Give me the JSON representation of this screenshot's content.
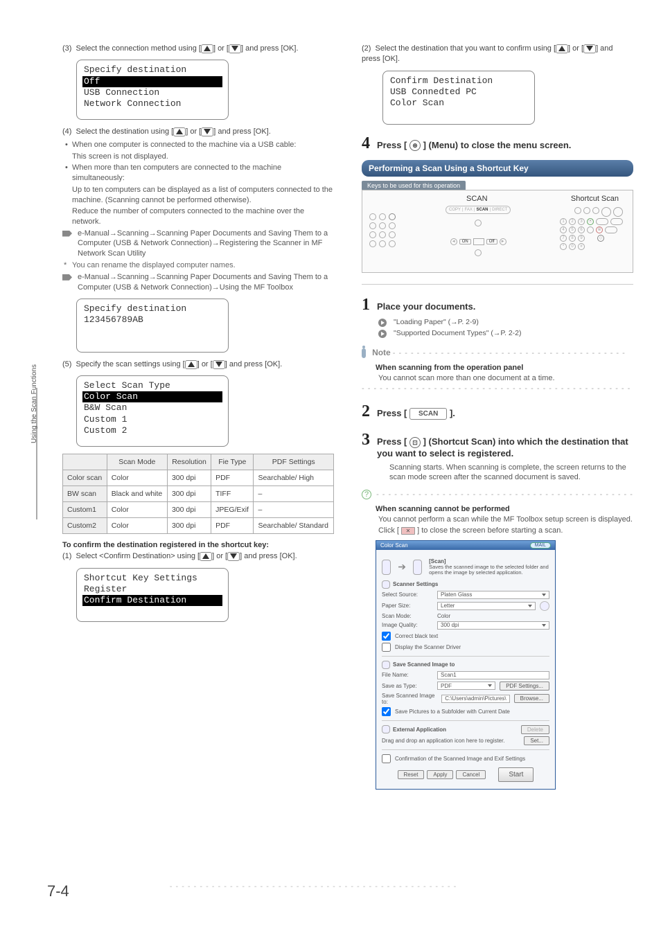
{
  "sidetab": "Using the Scan Functions",
  "pagenum": "7-4",
  "left": {
    "step3": "(3)  Select the connection method using [▲] or [▼] and press [OK].",
    "box1": {
      "title": "Specify destination",
      "hl": "Off",
      "l2": "USB Connection",
      "l3": "Network Connection"
    },
    "step4": "(4)  Select the destination using [▲] or [▼] and press [OK].",
    "b1": "When one computer is connected to the machine via a USB cable:",
    "b1s": "This screen is not displayed.",
    "b2": "When more than ten computers are connected to the machine simultaneously:",
    "b2s1": "Up to ten computers can be displayed as a list of computers connected to the machine. (Scanning cannot be performed otherwise).",
    "b2s2": "Reduce the number of computers connected to the machine over the network.",
    "ptr1": "e-Manual→Scanning→Scanning Paper Documents and Saving Them to a Computer (USB & Network Connection)→Registering the Scanner in MF Network Scan Utility",
    "star": "You can rename the displayed computer names.",
    "ptr2": "e-Manual→Scanning→Scanning Paper Documents and Saving Them to a Computer (USB & Network Connection)→Using the MF Toolbox",
    "box2": {
      "title": "Specify destination",
      "l1": "123456789AB"
    },
    "step5": "(5)  Specify the scan settings using [▲] or [▼] and press [OK].",
    "box3": {
      "title": "Select Scan Type",
      "hl": "Color Scan",
      "l2": "B&W Scan",
      "l3": "Custom 1",
      "l4": "Custom 2"
    },
    "table": {
      "headers": [
        "",
        "Scan Mode",
        "Resolution",
        "Fie Type",
        "PDF Settings"
      ],
      "rows": [
        [
          "Color scan",
          "Color",
          "300 dpi",
          "PDF",
          "Searchable/ High"
        ],
        [
          "BW scan",
          "Black and white",
          "300 dpi",
          "TIFF",
          "–"
        ],
        [
          "Custom1",
          "Color",
          "300 dpi",
          "JPEG/Exif",
          "–"
        ],
        [
          "Custom2",
          "Color",
          "300 dpi",
          "PDF",
          "Searchable/ Standard"
        ]
      ]
    },
    "confirm_head": "To confirm the destination registered in the shortcut key:",
    "confirm_step1": "(1)  Select <Confirm Destination> using [▲] or [▼] and press [OK].",
    "box4": {
      "title": "Shortcut Key Settings",
      "l1": "Register",
      "hl": "Confirm Destination"
    }
  },
  "right": {
    "step2top": "(2)  Select the destination that you want to confirm using [▲] or [▼] and press [OK].",
    "boxA": {
      "title": "Confirm Destination",
      "l1": "USB Connedted PC",
      "l2": "Color Scan"
    },
    "big4": "Press [       ] (Menu) to close the menu screen.",
    "menu_glyph": "⊛",
    "section": "Performing a Scan Using a Shortcut Key",
    "keys_label": "Keys to be used for this operation",
    "diag_scan": "SCAN",
    "diag_short": "Shortcut Scan",
    "big1": "Place your documents.",
    "ab1": "\"Loading Paper\" (→P. 2-9)",
    "ab2": "\"Supported Document Types\" (→P. 2-2)",
    "note": "Note",
    "note_head": "When scanning from the operation panel",
    "note_body": "You cannot scan more than one document at a time.",
    "big2_a": "Press [",
    "big2_b": "].",
    "scan_btn": "SCAN",
    "big3": "Press [      ] (Shortcut Scan) into which the destination that you want to select is registered.",
    "shortcut_glyph": "⊡",
    "big3_sub": "Scanning starts. When scanning is complete, the screen returns to the scan mode screen after the scanned document is saved.",
    "q_head": "When scanning cannot be performed",
    "q_body1": "You cannot perform a scan while the MF Toolbox setup screen is displayed.",
    "q_body2a": "Click [",
    "q_body2b": "] to close the screen before starting a scan.",
    "dialog": {
      "title": "Color Scan",
      "desc_head": "[Scan]",
      "desc": "Saves the scanned image to the selected folder and opens the image by selected application.",
      "sec1": "Scanner Settings",
      "src_l": "Select Source:",
      "src_v": "Platen Glass",
      "size_l": "Paper Size:",
      "size_v": "Letter",
      "mode_l": "Scan Mode:",
      "mode_v": "Color",
      "qual_l": "Image Quality:",
      "qual_v": "300 dpi",
      "chk1": "Correct black text",
      "chk2": "Display the Scanner Driver",
      "sec2": "Save Scanned Image to",
      "name_l": "File Name:",
      "name_v": "Scan1",
      "type_l": "Save as Type:",
      "type_v": "PDF",
      "pdf_btn": "PDF Settings...",
      "loc_l": "Save Scanned Image to:",
      "loc_v": "C:\\Users\\admin\\Pictures\\",
      "browse": "Browse...",
      "chk3": "Save Pictures to a Subfolder with Current Date",
      "sec3": "External Application",
      "drag": "Drag and drop an application icon here to register.",
      "del": "Delete",
      "set": "Set...",
      "chk4": "Confirmation of the Scanned Image and Exif Settings",
      "reset": "Reset",
      "apply": "Apply",
      "cancel": "Cancel",
      "start": "Start",
      "mail": "MAIL"
    }
  }
}
